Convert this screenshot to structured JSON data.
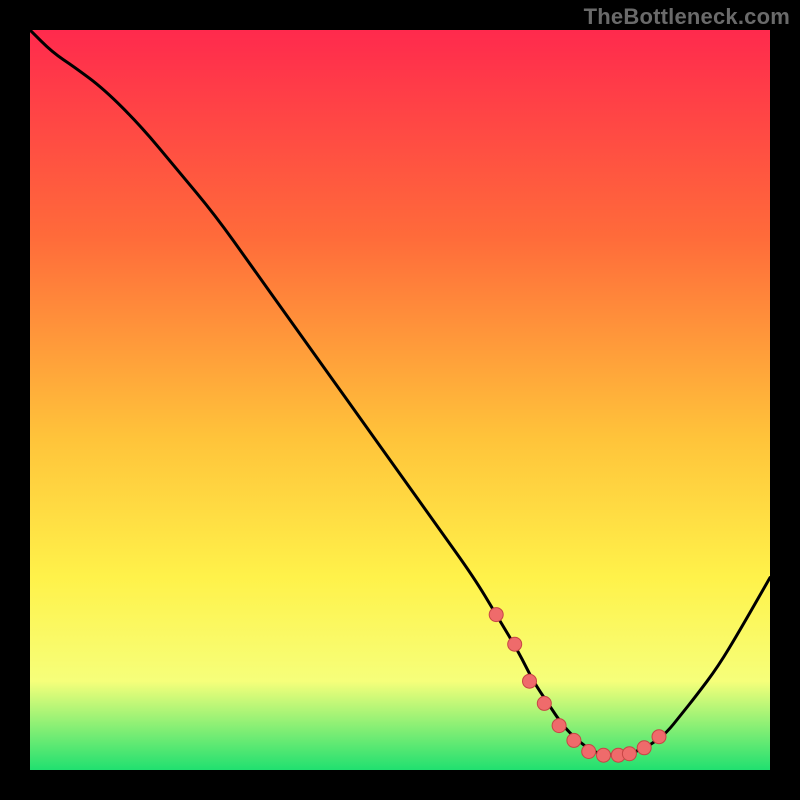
{
  "watermark": "TheBottleneck.com",
  "colors": {
    "background_black": "#000000",
    "gradient_top": "#ff2a4d",
    "gradient_mid1": "#ff6b3a",
    "gradient_mid2": "#ffc33a",
    "gradient_mid3": "#fff24a",
    "gradient_mid4": "#f6ff7a",
    "gradient_bottom": "#20e070",
    "curve": "#000000",
    "dot_fill": "#ef6b6b",
    "dot_stroke": "#c74545",
    "watermark_text": "#6a6a6a"
  },
  "chart_data": {
    "type": "line",
    "title": "",
    "xlabel": "",
    "ylabel": "",
    "xlim": [
      0,
      100
    ],
    "ylim": [
      0,
      100
    ],
    "grid": false,
    "legend": false,
    "series": [
      {
        "name": "curve",
        "x": [
          0,
          3,
          6,
          10,
          15,
          20,
          25,
          30,
          35,
          40,
          45,
          50,
          55,
          60,
          63,
          66,
          68,
          70,
          72,
          74,
          76,
          78,
          80,
          82,
          84,
          86,
          88,
          90,
          93,
          96,
          100
        ],
        "y": [
          100,
          97,
          95,
          92,
          87,
          81,
          75,
          68,
          61,
          54,
          47,
          40,
          33,
          26,
          21,
          16,
          12,
          9,
          6,
          4,
          2.5,
          2,
          2,
          2.5,
          3.5,
          5,
          7.5,
          10,
          14,
          19,
          26
        ]
      }
    ],
    "highlight_dots": {
      "x": [
        63,
        65.5,
        67.5,
        69.5,
        71.5,
        73.5,
        75.5,
        77.5,
        79.5,
        81,
        83,
        85
      ],
      "y": [
        21,
        17,
        12,
        9,
        6,
        4,
        2.5,
        2,
        2,
        2.2,
        3,
        4.5
      ]
    }
  }
}
